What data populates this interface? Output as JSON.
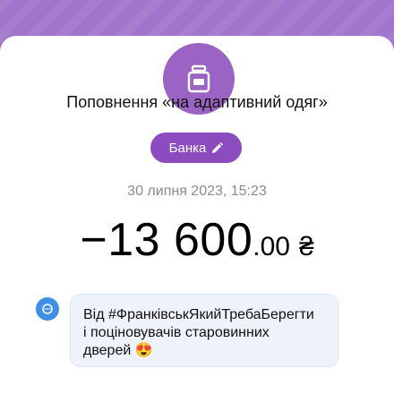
{
  "category": {
    "icon": "jar-icon"
  },
  "title": "Поповнення «на адаптивний одяг»",
  "bank_button": {
    "label": "Банка",
    "icon": "pencil-icon"
  },
  "datetime": "30 липня 2023, 15:23",
  "amount": {
    "integer": "−13 600",
    "decimal": ".00",
    "currency": "₴"
  },
  "comment": {
    "icon": "comment-icon",
    "lines": [
      "Від #ФранківськЯкийТребаБерегти",
      "і поціновувачів старовинних",
      "дверей 😍"
    ]
  },
  "colors": {
    "header": "#a275cd",
    "accent": "#9b64c4",
    "chip": "#8c4cbf",
    "comment_icon": "#3e8fe8",
    "comment_bg": "#eef3fb"
  }
}
